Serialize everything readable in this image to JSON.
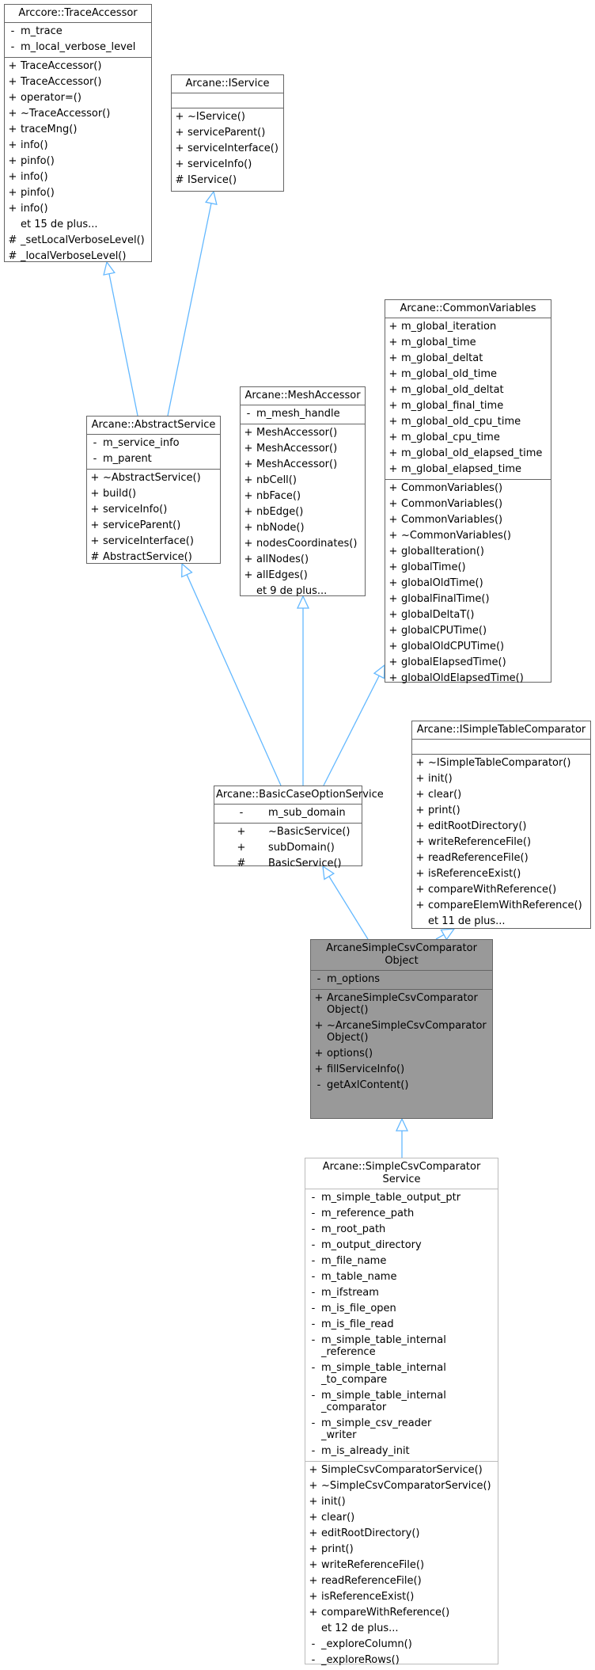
{
  "diagram": {
    "edge_color": "#63b8ff",
    "classes": {
      "trace_accessor": {
        "name": "Arccore::TraceAccessor",
        "attributes": [
          {
            "vis": "-",
            "name": "m_trace"
          },
          {
            "vis": "-",
            "name": "m_local_verbose_level"
          }
        ],
        "methods": [
          {
            "vis": "+",
            "name": "TraceAccessor()"
          },
          {
            "vis": "+",
            "name": "TraceAccessor()"
          },
          {
            "vis": "+",
            "name": "operator=()"
          },
          {
            "vis": "+",
            "name": "~TraceAccessor()"
          },
          {
            "vis": "+",
            "name": "traceMng()"
          },
          {
            "vis": "+",
            "name": "info()"
          },
          {
            "vis": "+",
            "name": "pinfo()"
          },
          {
            "vis": "+",
            "name": "info()"
          },
          {
            "vis": "+",
            "name": "pinfo()"
          },
          {
            "vis": "+",
            "name": "info()"
          },
          {
            "vis": "",
            "name": "et 15 de plus..."
          },
          {
            "vis": "#",
            "name": "_setLocalVerboseLevel()"
          },
          {
            "vis": "#",
            "name": "_localVerboseLevel()"
          }
        ]
      },
      "iservice": {
        "name": "Arcane::IService",
        "attributes": [],
        "methods": [
          {
            "vis": "+",
            "name": "~IService()"
          },
          {
            "vis": "+",
            "name": "serviceParent()"
          },
          {
            "vis": "+",
            "name": "serviceInterface()"
          },
          {
            "vis": "+",
            "name": "serviceInfo()"
          },
          {
            "vis": "#",
            "name": "IService()"
          }
        ]
      },
      "common_variables": {
        "name": "Arcane::CommonVariables",
        "attributes": [
          {
            "vis": "+",
            "name": "m_global_iteration"
          },
          {
            "vis": "+",
            "name": "m_global_time"
          },
          {
            "vis": "+",
            "name": "m_global_deltat"
          },
          {
            "vis": "+",
            "name": "m_global_old_time"
          },
          {
            "vis": "+",
            "name": "m_global_old_deltat"
          },
          {
            "vis": "+",
            "name": "m_global_final_time"
          },
          {
            "vis": "+",
            "name": "m_global_old_cpu_time"
          },
          {
            "vis": "+",
            "name": "m_global_cpu_time"
          },
          {
            "vis": "+",
            "name": "m_global_old_elapsed_time"
          },
          {
            "vis": "+",
            "name": "m_global_elapsed_time"
          }
        ],
        "methods": [
          {
            "vis": "+",
            "name": "CommonVariables()"
          },
          {
            "vis": "+",
            "name": "CommonVariables()"
          },
          {
            "vis": "+",
            "name": "CommonVariables()"
          },
          {
            "vis": "+",
            "name": "~CommonVariables()"
          },
          {
            "vis": "+",
            "name": "globalIteration()"
          },
          {
            "vis": "+",
            "name": "globalTime()"
          },
          {
            "vis": "+",
            "name": "globalOldTime()"
          },
          {
            "vis": "+",
            "name": "globalFinalTime()"
          },
          {
            "vis": "+",
            "name": "globalDeltaT()"
          },
          {
            "vis": "+",
            "name": "globalCPUTime()"
          },
          {
            "vis": "+",
            "name": "globalOldCPUTime()"
          },
          {
            "vis": "+",
            "name": "globalElapsedTime()"
          },
          {
            "vis": "+",
            "name": "globalOldElapsedTime()"
          }
        ]
      },
      "mesh_accessor": {
        "name": "Arcane::MeshAccessor",
        "attributes": [
          {
            "vis": "-",
            "name": "m_mesh_handle"
          }
        ],
        "methods": [
          {
            "vis": "+",
            "name": "MeshAccessor()"
          },
          {
            "vis": "+",
            "name": "MeshAccessor()"
          },
          {
            "vis": "+",
            "name": "MeshAccessor()"
          },
          {
            "vis": "+",
            "name": "nbCell()"
          },
          {
            "vis": "+",
            "name": "nbFace()"
          },
          {
            "vis": "+",
            "name": "nbEdge()"
          },
          {
            "vis": "+",
            "name": "nbNode()"
          },
          {
            "vis": "+",
            "name": "nodesCoordinates()"
          },
          {
            "vis": "+",
            "name": "allNodes()"
          },
          {
            "vis": "+",
            "name": "allEdges()"
          },
          {
            "vis": "",
            "name": "et 9 de plus..."
          }
        ]
      },
      "abstract_service": {
        "name": "Arcane::AbstractService",
        "attributes": [
          {
            "vis": "-",
            "name": "m_service_info"
          },
          {
            "vis": "-",
            "name": "m_parent"
          }
        ],
        "methods": [
          {
            "vis": "+",
            "name": "~AbstractService()"
          },
          {
            "vis": "+",
            "name": "build()"
          },
          {
            "vis": "+",
            "name": "serviceInfo()"
          },
          {
            "vis": "+",
            "name": "serviceParent()"
          },
          {
            "vis": "+",
            "name": "serviceInterface()"
          },
          {
            "vis": "#",
            "name": "AbstractService()"
          }
        ]
      },
      "isimple_table_comparator": {
        "name": "Arcane::ISimpleTableComparator",
        "attributes": [],
        "methods": [
          {
            "vis": "+",
            "name": "~ISimpleTableComparator()"
          },
          {
            "vis": "+",
            "name": "init()"
          },
          {
            "vis": "+",
            "name": "clear()"
          },
          {
            "vis": "+",
            "name": "print()"
          },
          {
            "vis": "+",
            "name": "editRootDirectory()"
          },
          {
            "vis": "+",
            "name": "writeReferenceFile()"
          },
          {
            "vis": "+",
            "name": "readReferenceFile()"
          },
          {
            "vis": "+",
            "name": "isReferenceExist()"
          },
          {
            "vis": "+",
            "name": "compareWithReference()"
          },
          {
            "vis": "+",
            "name": "compareElemWithReference()"
          },
          {
            "vis": "",
            "name": "et 11 de plus..."
          }
        ]
      },
      "basic_case_option_service": {
        "name": "Arcane::BasicCaseOptionService",
        "attributes": [
          {
            "vis": "-",
            "name": "m_sub_domain"
          }
        ],
        "methods": [
          {
            "vis": "+",
            "name": "~BasicService()"
          },
          {
            "vis": "+",
            "name": "subDomain()"
          },
          {
            "vis": "#",
            "name": "BasicService()"
          }
        ]
      },
      "arcane_simple_csv_comparator_object": {
        "name": "ArcaneSimpleCsvComparator\nObject",
        "attributes": [
          {
            "vis": "-",
            "name": "m_options"
          }
        ],
        "methods": [
          {
            "vis": "+",
            "name": "ArcaneSimpleCsvComparator\nObject()"
          },
          {
            "vis": "+",
            "name": "~ArcaneSimpleCsvComparator\nObject()"
          },
          {
            "vis": "+",
            "name": "options()"
          },
          {
            "vis": "+",
            "name": "fillServiceInfo()"
          },
          {
            "vis": "-",
            "name": "getAxlContent()"
          }
        ]
      },
      "simple_csv_comparator_service": {
        "name": "Arcane::SimpleCsvComparator\nService",
        "attributes": [
          {
            "vis": "-",
            "name": "m_simple_table_output_ptr"
          },
          {
            "vis": "-",
            "name": "m_reference_path"
          },
          {
            "vis": "-",
            "name": "m_root_path"
          },
          {
            "vis": "-",
            "name": "m_output_directory"
          },
          {
            "vis": "-",
            "name": "m_file_name"
          },
          {
            "vis": "-",
            "name": "m_table_name"
          },
          {
            "vis": "-",
            "name": "m_ifstream"
          },
          {
            "vis": "-",
            "name": "m_is_file_open"
          },
          {
            "vis": "-",
            "name": "m_is_file_read"
          },
          {
            "vis": "-",
            "name": "m_simple_table_internal\n_reference"
          },
          {
            "vis": "-",
            "name": "m_simple_table_internal\n_to_compare"
          },
          {
            "vis": "-",
            "name": "m_simple_table_internal\n_comparator"
          },
          {
            "vis": "-",
            "name": "m_simple_csv_reader\n_writer"
          },
          {
            "vis": "-",
            "name": "m_is_already_init"
          }
        ],
        "methods": [
          {
            "vis": "+",
            "name": "SimpleCsvComparatorService()"
          },
          {
            "vis": "+",
            "name": "~SimpleCsvComparatorService()"
          },
          {
            "vis": "+",
            "name": "init()"
          },
          {
            "vis": "+",
            "name": "clear()"
          },
          {
            "vis": "+",
            "name": "editRootDirectory()"
          },
          {
            "vis": "+",
            "name": "print()"
          },
          {
            "vis": "+",
            "name": "writeReferenceFile()"
          },
          {
            "vis": "+",
            "name": "readReferenceFile()"
          },
          {
            "vis": "+",
            "name": "isReferenceExist()"
          },
          {
            "vis": "+",
            "name": "compareWithReference()"
          },
          {
            "vis": "",
            "name": "et 12 de plus..."
          },
          {
            "vis": "-",
            "name": "_exploreColumn()"
          },
          {
            "vis": "-",
            "name": "_exploreRows()"
          }
        ]
      }
    },
    "inheritance": [
      {
        "child": "abstract_service",
        "parent": "trace_accessor"
      },
      {
        "child": "abstract_service",
        "parent": "iservice"
      },
      {
        "child": "basic_case_option_service",
        "parent": "abstract_service"
      },
      {
        "child": "basic_case_option_service",
        "parent": "mesh_accessor"
      },
      {
        "child": "basic_case_option_service",
        "parent": "common_variables"
      },
      {
        "child": "arcane_simple_csv_comparator_object",
        "parent": "basic_case_option_service"
      },
      {
        "child": "arcane_simple_csv_comparator_object",
        "parent": "isimple_table_comparator"
      },
      {
        "child": "simple_csv_comparator_service",
        "parent": "arcane_simple_csv_comparator_object"
      }
    ]
  }
}
